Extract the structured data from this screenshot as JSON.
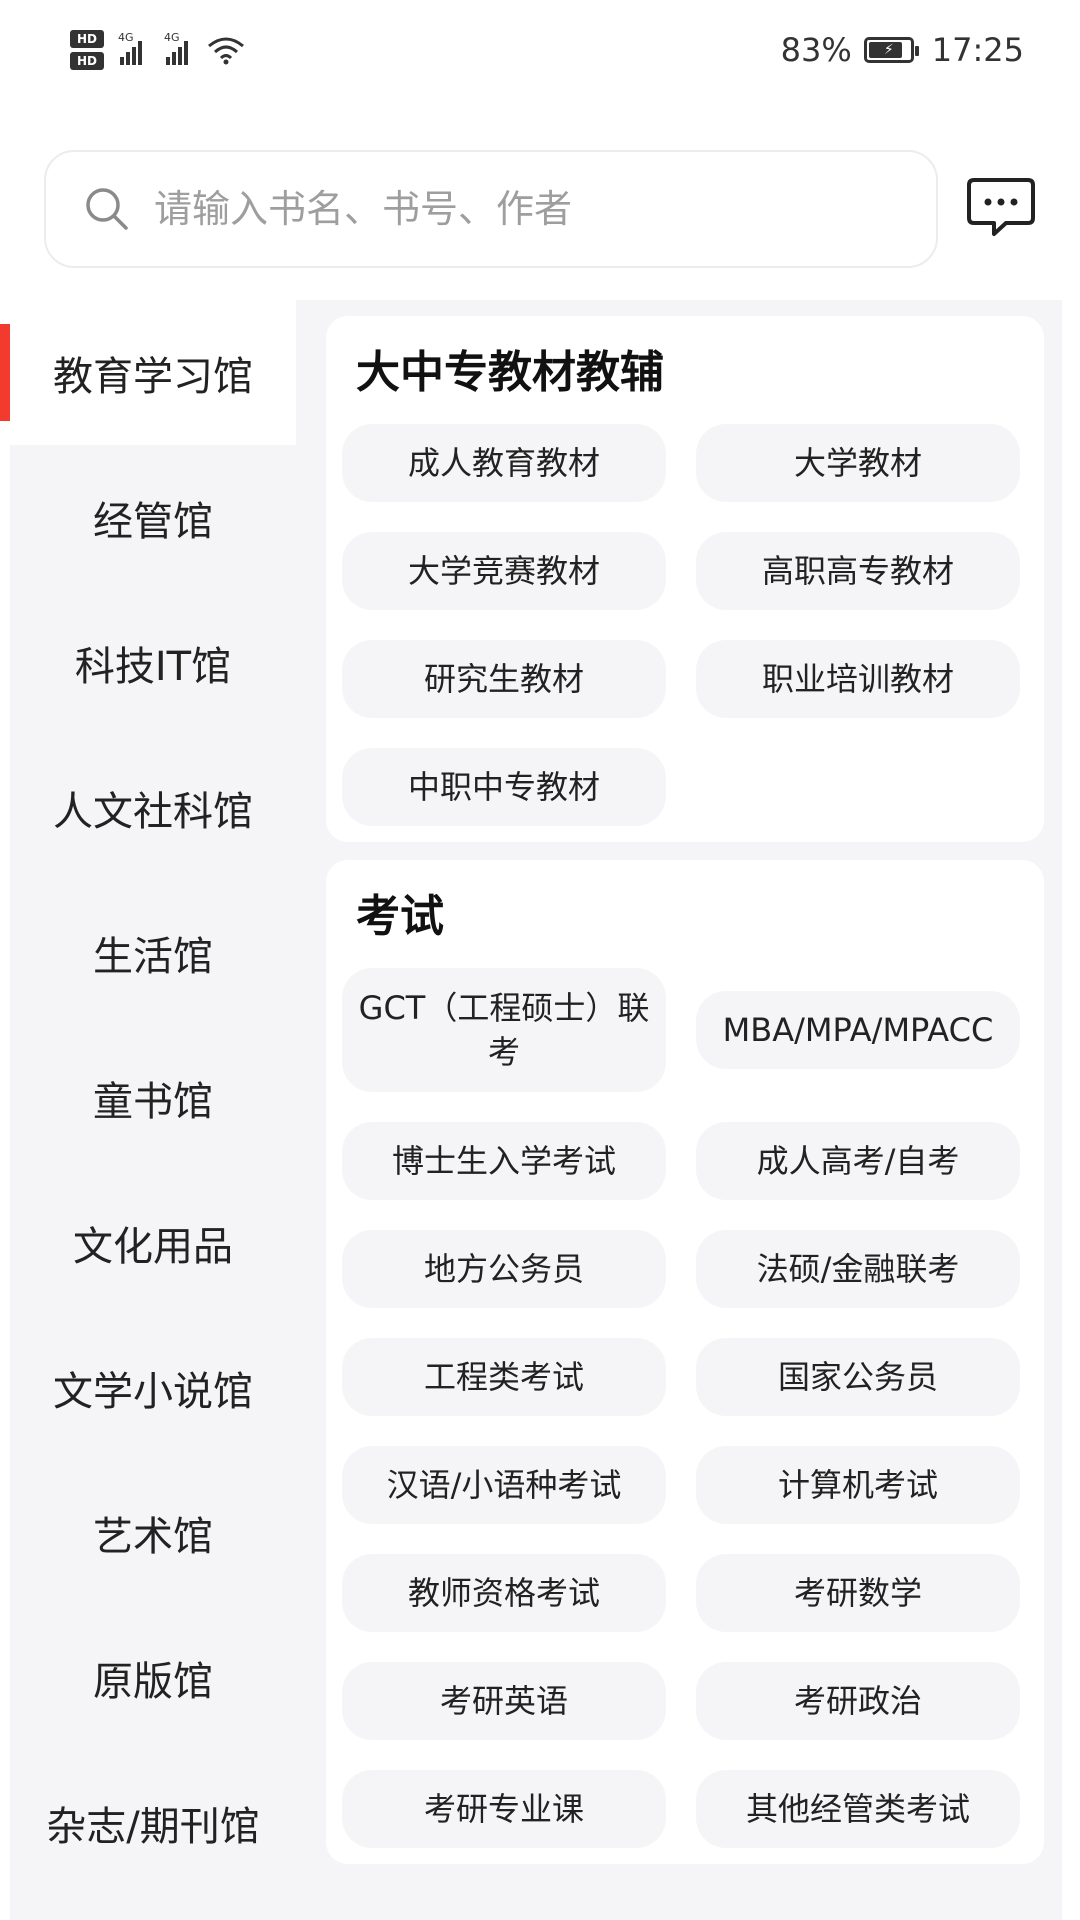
{
  "status_bar": {
    "hd1": "HD",
    "hd2": "HD",
    "net1": "4G",
    "net2": "4G",
    "battery": "83%",
    "time": "17:25",
    "battery_level": 0.83
  },
  "search": {
    "placeholder": "请输入书名、书号、作者"
  },
  "sidebar": {
    "items": [
      "教育学习馆",
      "经管馆",
      "科技IT馆",
      "人文社科馆",
      "生活馆",
      "童书馆",
      "文化用品",
      "文学小说馆",
      "艺术馆",
      "原版馆",
      "杂志/期刊馆"
    ]
  },
  "sections": [
    {
      "title": "大中专教材教辅",
      "items": [
        "成人教育教材",
        "大学教材",
        "大学竞赛教材",
        "高职高专教材",
        "研究生教材",
        "职业培训教材",
        "中职中专教材"
      ]
    },
    {
      "title": "考试",
      "items": [
        "GCT（工程硕士）联考",
        "MBA/MPA/MPACC",
        "博士生入学考试",
        "成人高考/自考",
        "地方公务员",
        "法硕/金融联考",
        "工程类考试",
        "国家公务员",
        "汉语/小语种考试",
        "计算机考试",
        "教师资格考试",
        "考研数学",
        "考研英语",
        "考研政治",
        "考研专业课",
        "其他经管类考试"
      ]
    }
  ],
  "colors": {
    "accent": "#f23a2f",
    "chip_bg": "#f5f5f7",
    "placeholder": "#9e9e9e"
  }
}
